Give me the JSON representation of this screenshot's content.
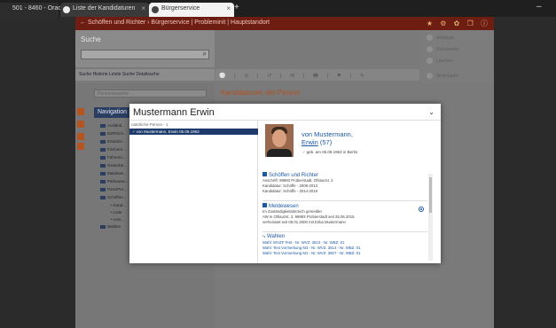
{
  "browser": {
    "tabs": [
      {
        "label": "501 - 8460 - Orac..."
      },
      {
        "label": "Liste der Kandidaturen"
      },
      {
        "label": "Bürgerservice"
      }
    ],
    "new_tab": "+",
    "close": "×",
    "minimize": "–"
  },
  "app": {
    "breadcrumb": "Schöffen und Richter  ›  Bürgerservice | Probleminit | Hauptstandort",
    "back_glyph": "←",
    "toolbar_icons": "★ ⚙ ✿ ❐ ⓘ",
    "search_label": "Suche",
    "search_value": "",
    "toolbar_items": "Suche  Historie  Letzte Suche  Detailsuche",
    "icon_row": "⚪ | ⊙ | ↺ | ✉ | 🖶 | ⚑ | ✎",
    "right_buttons": [
      "Anhänge",
      "Dokumente",
      "Löschen",
      "Verknüpfen"
    ],
    "person_input_placeholder": "Personensuche",
    "kandidaturen_title": "Kandidaturen der Person",
    "nav_header": "Navigation",
    "nav_items": [
      "Ausländ...",
      "EZR/Sch...",
      "Erlaubni...",
      "Fischere...",
      "Führersc...",
      "Gewerbe...",
      "Meldewe...",
      "Parkausw...",
      "Pass/Per...",
      "Schöffen..."
    ],
    "nav_subitems": [
      "Kand...",
      "Liste",
      "vom..."
    ],
    "nav_last": "Wahlen"
  },
  "modal": {
    "title": "Mustermann Erwin",
    "category": "natürliche Person - 1",
    "selected_entry": "von Mustermann, Erwin 05.09.1963",
    "person_name_line1": "von Mustermann,",
    "person_name_line2": "Erwin",
    "person_age": "(57)",
    "birth": "geb. am 05.09.1963 in Berlin",
    "sections": {
      "schoeffen": {
        "title": "Schöffen und Richter",
        "lines": [
          "Anschrift: 99993 Probierstadt, Ohlauzst. 2",
          "Kandidatur: Schöffe - 2008-2013",
          "Kandidatur: Schöffe - 2014-2019"
        ]
      },
      "melde": {
        "title": "Meldewesen",
        "lines": [
          "Im Zuständigkeitsbereich gemeldet",
          "AW in Ohlauzst. 2, 99993 Probierstadt seit 25.06.2015",
          "verheiratet seit 08.01.2000 mit Erika Mustermann"
        ]
      },
      "wahlen": {
        "title": "Wahlen",
        "lines": [
          "Wahl: WVZF Test - Nr. WVZ: 3513 - Nr. WBZ: 01",
          "Wahl: Test Vormerkung M3 - Nr. WVZ: 3514 - Nr. WBZ: 01",
          "Wahl: Test Vormerkung M1 - Nr. WVZ: 3507 - Nr. WBZ: 01"
        ]
      }
    }
  }
}
